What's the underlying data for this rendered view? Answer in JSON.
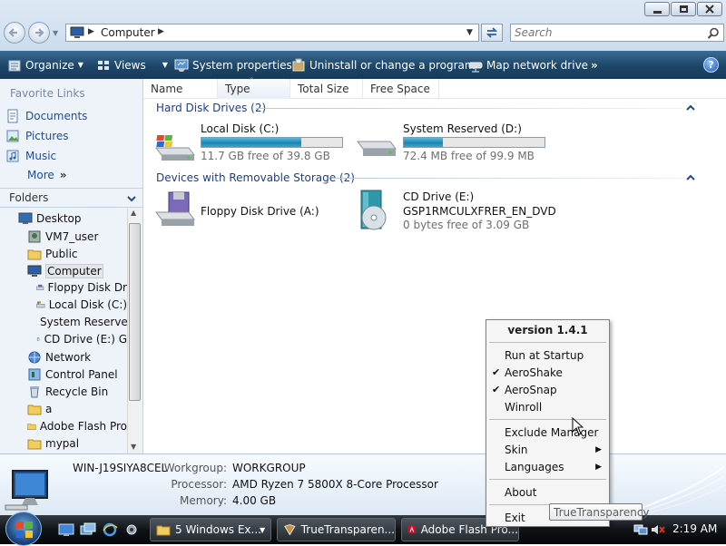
{
  "window": {
    "address_path": "Computer",
    "search_placeholder": "Search"
  },
  "toolbar": {
    "organize": "Organize",
    "views": "Views",
    "system_properties": "System properties",
    "uninstall": "Uninstall or change a program",
    "map_drive": "Map network drive",
    "more": "»"
  },
  "nav": {
    "favorite_links_title": "Favorite Links",
    "favorites": [
      "Documents",
      "Pictures",
      "Music"
    ],
    "more": "More",
    "folders_title": "Folders",
    "tree": [
      "Desktop",
      "VM7_user",
      "Public",
      "Computer",
      "Floppy Disk Dr",
      "Local Disk (C:)",
      "System Reserve",
      "CD Drive (E:) G",
      "Network",
      "Control Panel",
      "Recycle Bin",
      "a",
      "Adobe Flash Pro",
      "mypal"
    ]
  },
  "columns": [
    "Name",
    "Type",
    "Total Size",
    "Free Space"
  ],
  "groups": {
    "hard_disks": "Hard Disk Drives (2)",
    "removable": "Devices with Removable Storage (2)"
  },
  "drives": {
    "c": {
      "name": "Local Disk (C:)",
      "free_text": "11.7 GB free of 39.8 GB",
      "used_fraction": 0.71
    },
    "d": {
      "name": "System Reserved (D:)",
      "free_text": "72.4 MB free of 99.9 MB",
      "used_fraction": 0.28
    },
    "floppy": {
      "name": "Floppy Disk Drive (A:)"
    },
    "cd": {
      "name": "CD Drive (E:)",
      "label": "GSP1RMCULXFRER_EN_DVD",
      "free_text": "0 bytes free of 3.09 GB"
    }
  },
  "details": {
    "computer_name": "WIN-J19SIYA8CEL",
    "workgroup_label": "Workgroup:",
    "workgroup": "WORKGROUP",
    "processor_label": "Processor:",
    "processor": "AMD Ryzen 7 5800X 8-Core Processor",
    "memory_label": "Memory:",
    "memory": "4.00 GB"
  },
  "taskbar": {
    "windows_explorer": "5 Windows Ex...",
    "truetransparency": "TrueTransparen...",
    "adobe_flash": "Adobe Flash Pro...",
    "clock": "2:19 AM"
  },
  "context_menu": {
    "version": "version 1.4.1",
    "run_at_startup": "Run at Startup",
    "aeroshake": "AeroShake",
    "aerosnap": "AeroSnap",
    "winroll": "Winroll",
    "exclude_manager": "Exclude Manager",
    "skin": "Skin",
    "languages": "Languages",
    "about": "About",
    "exit": "Exit",
    "checked": [
      "AeroShake",
      "AeroSnap"
    ]
  },
  "tooltip": "TrueTransparency"
}
